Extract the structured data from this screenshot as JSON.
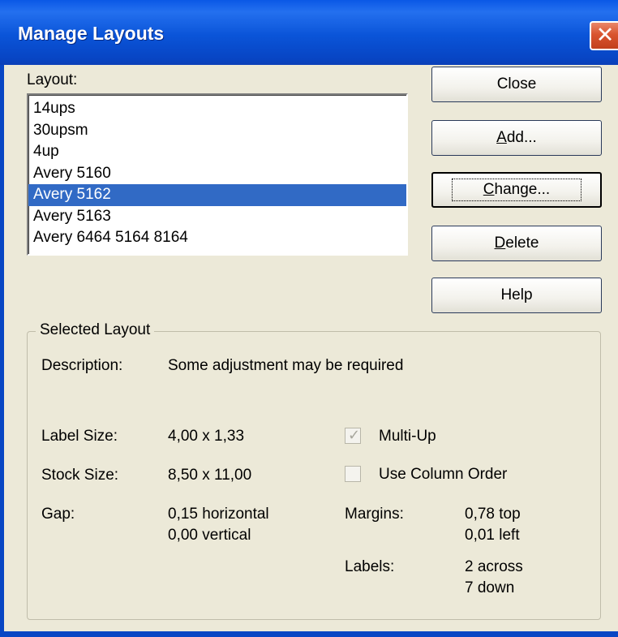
{
  "window": {
    "title": "Manage Layouts",
    "close_glyph": "✕"
  },
  "layout_list": {
    "label": "Layout:",
    "items": [
      {
        "label": "14ups",
        "selected": false
      },
      {
        "label": "30upsm",
        "selected": false
      },
      {
        "label": "4up",
        "selected": false
      },
      {
        "label": "Avery 5160",
        "selected": false
      },
      {
        "label": "Avery 5162",
        "selected": true
      },
      {
        "label": "Avery 5163",
        "selected": false
      },
      {
        "label": "Avery 6464  5164  8164",
        "selected": false
      }
    ]
  },
  "buttons": {
    "close": {
      "label": "Close"
    },
    "add": {
      "mnemonic": "A",
      "rest": "dd..."
    },
    "change": {
      "mnemonic": "C",
      "rest": "hange..."
    },
    "delete": {
      "mnemonic": "D",
      "rest": "elete"
    },
    "help": {
      "label": "Help"
    }
  },
  "selected_layout": {
    "group_title": "Selected Layout",
    "description_label": "Description:",
    "description_value": "Some adjustment may be required",
    "label_size_label": "Label Size:",
    "label_size_value": "4,00 x 1,33",
    "stock_size_label": "Stock Size:",
    "stock_size_value": "8,50 x 11,00",
    "gap_label": "Gap:",
    "gap_horizontal": "0,15 horizontal",
    "gap_vertical": "0,00 vertical",
    "multi_up": {
      "label": "Multi-Up",
      "checked": true,
      "disabled": true
    },
    "column_order": {
      "label": "Use Column Order",
      "checked": false,
      "disabled": true
    },
    "margins_label": "Margins:",
    "margins_top": "0,78 top",
    "margins_left": "0,01 left",
    "labels_label": "Labels:",
    "labels_across": "2 across",
    "labels_down": "7 down"
  },
  "colors": {
    "titlebar": "#0a54d8",
    "selection": "#316ac5",
    "dialog_bg": "#ece9d8",
    "close_button": "#d9542f"
  }
}
